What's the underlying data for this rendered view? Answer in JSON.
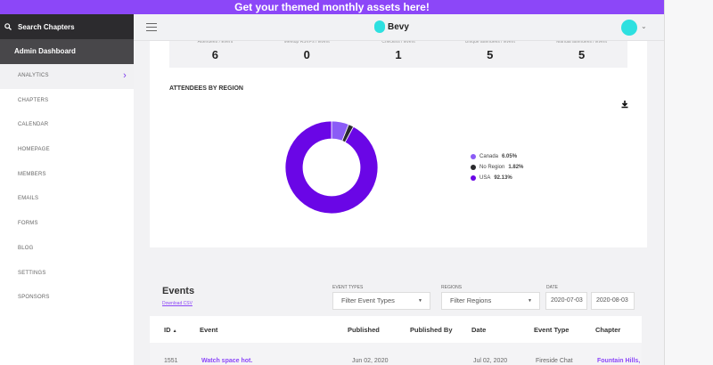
{
  "banner": {
    "text": "Get your themed monthly assets here!"
  },
  "sidebar": {
    "search_label": "Search Chapters",
    "admin_label": "Admin Dashboard",
    "items": [
      {
        "label": "ANALYTICS",
        "active": true
      },
      {
        "label": "CHAPTERS"
      },
      {
        "label": "CALENDAR"
      },
      {
        "label": "HOMEPAGE"
      },
      {
        "label": "MEMBERS"
      },
      {
        "label": "EMAILS"
      },
      {
        "label": "FORMS"
      },
      {
        "label": "BLOG"
      },
      {
        "label": "SETTINGS"
      },
      {
        "label": "SPONSORS"
      }
    ]
  },
  "header": {
    "brand": "Bevy",
    "accent": "#2de0e0"
  },
  "stats": [
    {
      "label": "Attendees / Event",
      "value": "6"
    },
    {
      "label": "Meetup RSVPs / Event",
      "value": "0"
    },
    {
      "label": "Checkins / Event",
      "value": "1"
    },
    {
      "label": "Unique attendees / Event",
      "value": "5"
    },
    {
      "label": "Manual attendees / Event",
      "value": "5"
    }
  ],
  "chart": {
    "title": "ATTENDEES BY REGION",
    "download_icon": "download-icon",
    "slices": [
      {
        "name": "Canada",
        "pct_label": "6.05%",
        "value": 6.05,
        "color": "#8b5cf6"
      },
      {
        "name": "No Region",
        "pct_label": "1.82%",
        "value": 1.82,
        "color": "#2a2a2e"
      },
      {
        "name": "USA",
        "pct_label": "92.13%",
        "value": 92.13,
        "color": "#6a06e6"
      }
    ]
  },
  "events": {
    "title": "Events",
    "download_csv": "Download CSV",
    "filters": {
      "event_types_label": "EVENT TYPES",
      "event_types_value": "Filter Event Types",
      "regions_label": "REGIONS",
      "regions_value": "Filter Regions",
      "date_label": "DATE",
      "date_from": "2020-07-03",
      "date_to": "2020-08-03"
    },
    "columns": [
      "ID",
      "Event",
      "Published",
      "Published By",
      "Date",
      "Event Type",
      "Chapter"
    ],
    "sort_indicator": "▲",
    "rows": [
      {
        "id": "1551",
        "event": "Watch space hot.",
        "published": "Jun 02, 2020",
        "published_by": "",
        "date": "Jul 02, 2020",
        "event_type": "Fireside Chat",
        "chapter": "Fountain Hills,"
      }
    ]
  }
}
